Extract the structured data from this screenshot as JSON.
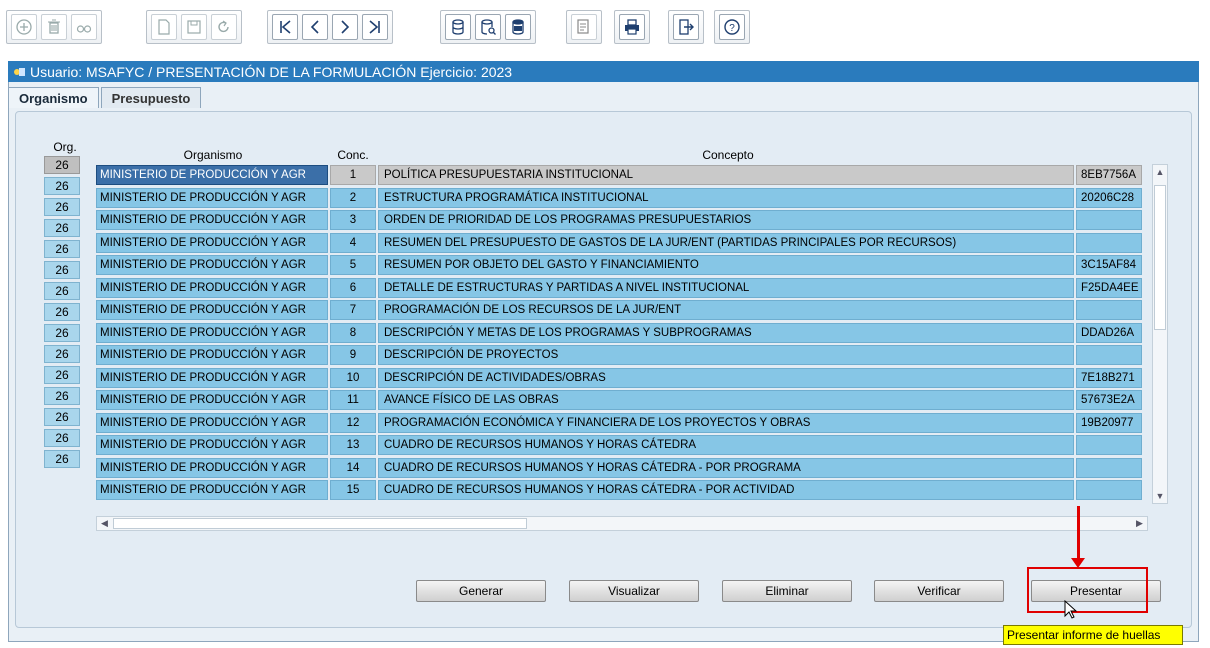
{
  "toolbar": {
    "groups": [
      [
        "plus-icon",
        "trash-icon",
        "binoculars-icon"
      ],
      [
        "new-document-icon",
        "save-icon",
        "undo-icon"
      ],
      [
        "first-record-icon",
        "previous-record-icon",
        "next-record-icon",
        "last-record-icon"
      ],
      [
        "database-query-icon",
        "database-search-icon",
        "database-execute-icon"
      ],
      [
        "report-icon"
      ],
      [
        "print-icon"
      ],
      [
        "exit-icon"
      ],
      [
        "help-icon"
      ]
    ]
  },
  "title": {
    "text": "Usuario: MSAFYC  /  PRESENTACIÓN DE LA FORMULACIÓN  Ejercicio: 2023"
  },
  "tabs": [
    {
      "label": "Organismo",
      "active": true
    },
    {
      "label": "Presupuesto",
      "active": false
    }
  ],
  "grid": {
    "org_header": "Org.",
    "headers": {
      "organismo": "Organismo",
      "conc": "Conc.",
      "concepto": "Concepto"
    },
    "rows": [
      {
        "org": "26",
        "organismo": "MINISTERIO DE PRODUCCIÓN Y AGR",
        "conc": "1",
        "concepto": "POLÍTICA PRESUPUESTARIA INSTITUCIONAL",
        "hash": "8EB7756A"
      },
      {
        "org": "26",
        "organismo": "MINISTERIO DE PRODUCCIÓN Y AGR",
        "conc": "2",
        "concepto": "ESTRUCTURA PROGRAMÁTICA INSTITUCIONAL",
        "hash": "20206C28"
      },
      {
        "org": "26",
        "organismo": "MINISTERIO DE PRODUCCIÓN Y AGR",
        "conc": "3",
        "concepto": "ORDEN DE PRIORIDAD DE LOS PROGRAMAS PRESUPUESTARIOS",
        "hash": ""
      },
      {
        "org": "26",
        "organismo": "MINISTERIO DE PRODUCCIÓN Y AGR",
        "conc": "4",
        "concepto": "RESUMEN DEL PRESUPUESTO DE GASTOS DE LA JUR/ENT (PARTIDAS PRINCIPALES POR RECURSOS)",
        "hash": ""
      },
      {
        "org": "26",
        "organismo": "MINISTERIO DE PRODUCCIÓN Y AGR",
        "conc": "5",
        "concepto": "RESUMEN POR OBJETO DEL GASTO Y FINANCIAMIENTO",
        "hash": "3C15AF84"
      },
      {
        "org": "26",
        "organismo": "MINISTERIO DE PRODUCCIÓN Y AGR",
        "conc": "6",
        "concepto": "DETALLE DE ESTRUCTURAS Y PARTIDAS A NIVEL INSTITUCIONAL",
        "hash": "F25DA4EE"
      },
      {
        "org": "26",
        "organismo": "MINISTERIO DE PRODUCCIÓN Y AGR",
        "conc": "7",
        "concepto": "PROGRAMACIÓN DE LOS RECURSOS DE LA JUR/ENT",
        "hash": ""
      },
      {
        "org": "26",
        "organismo": "MINISTERIO DE PRODUCCIÓN Y AGR",
        "conc": "8",
        "concepto": "DESCRIPCIÓN Y METAS DE LOS PROGRAMAS Y SUBPROGRAMAS",
        "hash": "DDAD26A"
      },
      {
        "org": "26",
        "organismo": "MINISTERIO DE PRODUCCIÓN Y AGR",
        "conc": "9",
        "concepto": "DESCRIPCIÓN DE PROYECTOS",
        "hash": ""
      },
      {
        "org": "26",
        "organismo": "MINISTERIO DE PRODUCCIÓN Y AGR",
        "conc": "10",
        "concepto": "DESCRIPCIÓN DE ACTIVIDADES/OBRAS",
        "hash": "7E18B271"
      },
      {
        "org": "26",
        "organismo": "MINISTERIO DE PRODUCCIÓN Y AGR",
        "conc": "11",
        "concepto": "AVANCE FÍSICO DE LAS OBRAS",
        "hash": "57673E2A"
      },
      {
        "org": "26",
        "organismo": "MINISTERIO DE PRODUCCIÓN Y AGR",
        "conc": "12",
        "concepto": "PROGRAMACIÓN ECONÓMICA Y FINANCIERA DE LOS PROYECTOS Y OBRAS",
        "hash": "19B20977"
      },
      {
        "org": "26",
        "organismo": "MINISTERIO DE PRODUCCIÓN Y AGR",
        "conc": "13",
        "concepto": "CUADRO DE RECURSOS HUMANOS Y HORAS CÁTEDRA",
        "hash": ""
      },
      {
        "org": "26",
        "organismo": "MINISTERIO DE PRODUCCIÓN Y AGR",
        "conc": "14",
        "concepto": "CUADRO DE RECURSOS HUMANOS Y HORAS CÁTEDRA - POR PROGRAMA",
        "hash": ""
      },
      {
        "org": "26",
        "organismo": "MINISTERIO DE PRODUCCIÓN Y AGR",
        "conc": "15",
        "concepto": "CUADRO DE RECURSOS HUMANOS Y HORAS CÁTEDRA - POR ACTIVIDAD",
        "hash": ""
      }
    ]
  },
  "buttons": {
    "generar": "Generar",
    "visualizar": "Visualizar",
    "eliminar": "Eliminar",
    "verificar": "Verificar",
    "presentar": "Presentar"
  },
  "tooltip": "Presentar informe de huellas",
  "colors": {
    "title_bar": "#2a7bbd",
    "row_fill": "#86c6e6",
    "highlight": "#e00000",
    "tooltip": "#ffff00"
  }
}
